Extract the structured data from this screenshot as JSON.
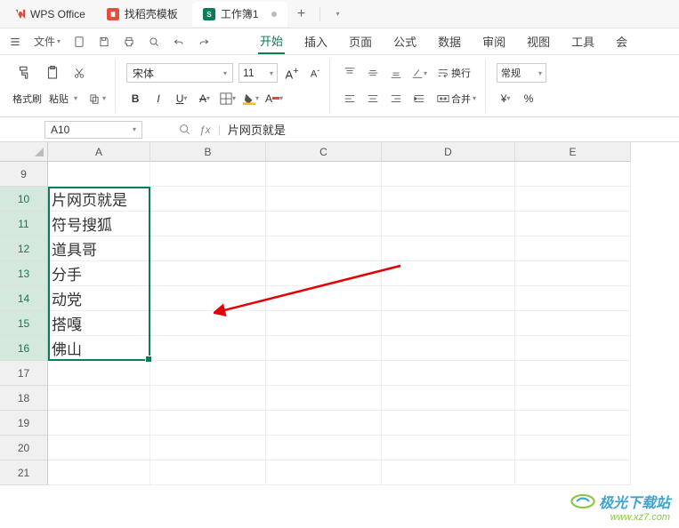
{
  "app": {
    "name": "WPS Office"
  },
  "tabs": [
    {
      "label": "找稻壳模板"
    },
    {
      "label": "工作簿1"
    }
  ],
  "quickbar": {
    "file_label": "文件"
  },
  "menu": {
    "items": [
      "开始",
      "插入",
      "页面",
      "公式",
      "数据",
      "审阅",
      "视图",
      "工具",
      "会"
    ],
    "active": "开始"
  },
  "ribbon": {
    "format_painter": "格式刷",
    "paste": "粘贴",
    "font_name": "宋体",
    "font_size": "11",
    "wrap": "换行",
    "merge": "合并",
    "number_format": "常规",
    "currency": "¥",
    "percent": "%"
  },
  "formula": {
    "cell_ref": "A10",
    "fx_label": "ƒx",
    "value": "片网页就是"
  },
  "columns": [
    "A",
    "B",
    "C",
    "D",
    "E"
  ],
  "row_start": 9,
  "row_end": 21,
  "cells": {
    "A10": "片网页就是",
    "A11": "符号搜狐",
    "A12": "道具哥",
    "A13": "分手",
    "A14": "动党",
    "A15": "搭嘎",
    "A16": "佛山"
  },
  "selection": {
    "from": "A10",
    "to": "A16"
  },
  "watermark": {
    "text": "极光下载站",
    "url": "www.xz7.com"
  }
}
